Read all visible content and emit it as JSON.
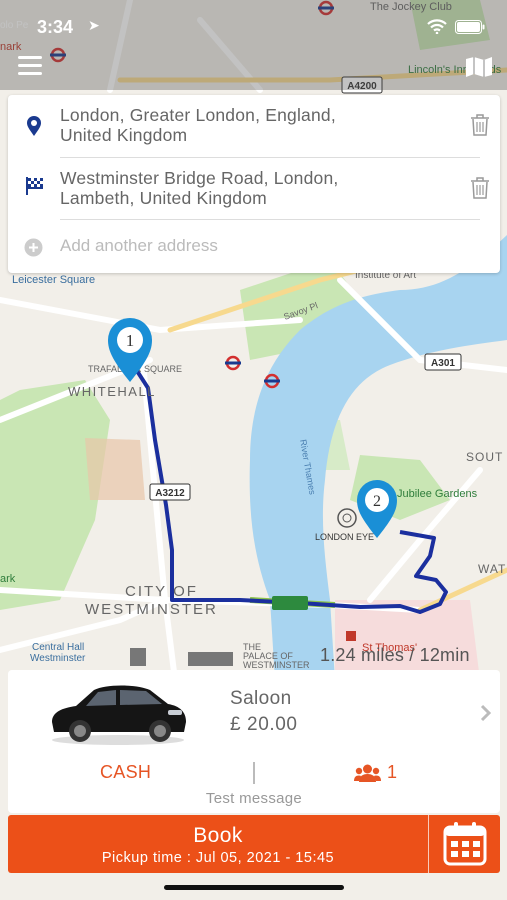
{
  "status_bar": {
    "time": "3:34"
  },
  "map": {
    "labels": {
      "the_jockey_club": "The Jockey Club",
      "lincolns_inn_fields": "Lincoln's Inn Fields",
      "a4200": "A4200",
      "leicester_square": "Leicester Square",
      "institute_of_art": "Institute of Art",
      "savoy_pl": "Savoy Pl",
      "a301": "A301",
      "trafalgar_square": "TRAFALGAR SQUARE",
      "whitehall": "WHITEHALL",
      "river_thames": "River Thames",
      "jubilee_gardens": "Jubilee Gardens",
      "south": "SOUT",
      "a3212": "A3212",
      "london_eye": "LONDON EYE",
      "wat": "WAT",
      "city_of": "CITY OF",
      "westminster": "WESTMINSTER",
      "central_hall": "Central Hall",
      "central_hall_2": "Westminster",
      "palace_1": "THE",
      "palace_2": "PALACE OF",
      "palace_3": "WESTMINSTER",
      "st_thomas": "St Thomas'",
      "park": "ark",
      "polo": "olo Pe",
      "mark": "nark"
    },
    "markers": [
      "1",
      "2"
    ]
  },
  "addresses": [
    {
      "line1": "London, Greater London, England,",
      "line2": "United Kingdom"
    },
    {
      "line1": "Westminster Bridge Road, London,",
      "line2": "Lambeth, United Kingdom"
    }
  ],
  "add_address_placeholder": "Add another address",
  "route": {
    "distance_text": "1.24 miles / 12min"
  },
  "vehicle": {
    "name": "Saloon",
    "price": "£ 20.00"
  },
  "payment_method": "CASH",
  "passengers": "1",
  "message": "Test message",
  "book": {
    "title": "Book",
    "pickup_time": "Pickup time : Jul 05, 2021 - 15:45"
  },
  "colors": {
    "accent": "#ec5018",
    "route": "#1b2f9e",
    "marker": "#1a8fd6",
    "water": "#a8d4f0"
  }
}
